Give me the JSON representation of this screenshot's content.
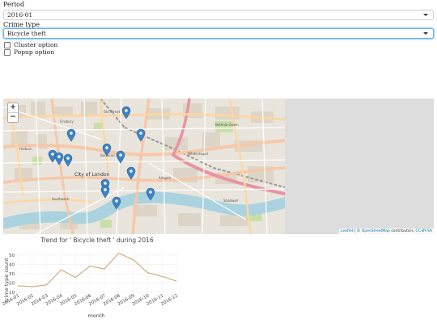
{
  "controls": {
    "period_label": "Period",
    "period_value": "2016-01",
    "crime_label": "Crime type",
    "crime_value": "Bicycle theft",
    "cluster_label": "Cluster option",
    "popup_label": "Popup option"
  },
  "map": {
    "zoom_in": "+",
    "zoom_out": "−",
    "attribution": {
      "leaflet": "Leaflet",
      "sep": " | © ",
      "osm": "OpenStreetMap",
      "contrib": " contributors, ",
      "license": "CC-BY-SA"
    },
    "street_labels": [
      "Old Street",
      "Holborn",
      "City of London",
      "Bethnal Green",
      "Whitechapel",
      "Southwark",
      "Shadwell",
      "Finsbury",
      "Aldgate",
      "Barbican"
    ]
  },
  "chart_data": {
    "type": "line",
    "title": "Trend for ' Bicycle theft ' during 2016",
    "xlabel": "month",
    "ylabel": "crime type count",
    "categories": [
      "2016-01",
      "2016-02",
      "2016-03",
      "2016-04",
      "2016-05",
      "2016-06",
      "2016-07",
      "2016-08",
      "2016-09",
      "2016-10",
      "2016-11",
      "2016-12"
    ],
    "values": [
      17,
      16,
      18,
      34,
      26,
      38,
      35,
      52,
      45,
      31,
      27,
      22
    ],
    "yticks": [
      10,
      20,
      30,
      40,
      50
    ],
    "ylim": [
      10,
      55
    ],
    "color": "#c8a877",
    "grid": true
  }
}
